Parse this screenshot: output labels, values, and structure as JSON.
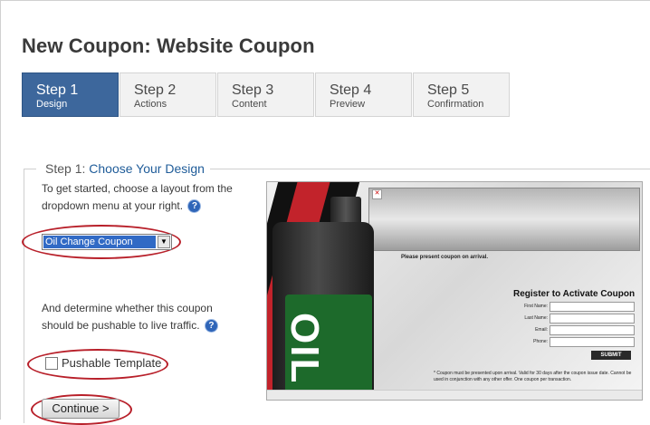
{
  "page": {
    "title": "New Coupon: Website Coupon"
  },
  "steps": [
    {
      "num": "Step 1",
      "label": "Design"
    },
    {
      "num": "Step 2",
      "label": "Actions"
    },
    {
      "num": "Step 3",
      "label": "Content"
    },
    {
      "num": "Step 4",
      "label": "Preview"
    },
    {
      "num": "Step 5",
      "label": "Confirmation"
    }
  ],
  "section": {
    "step_label": "Step 1:",
    "title": "Choose Your Design",
    "intro_line1": "To get started, choose a layout from the",
    "intro_line2": "dropdown menu at your right.",
    "layout_select": {
      "value": "Oil Change Coupon"
    },
    "pushable_line1": "And determine whether this coupon",
    "pushable_line2": "should be pushable to live traffic.",
    "pushable_checkbox_label": "Pushable Template",
    "pushable_checked": false,
    "continue_label": "Continue >"
  },
  "preview": {
    "present_text": "Please present coupon on arrival.",
    "bottle_text": "OIL",
    "register_title": "Register to Activate Coupon",
    "fields": [
      "First Name:",
      "Last Name:",
      "Email:",
      "Phone:"
    ],
    "submit_label": "SUBMIT",
    "fine_print": "* Coupon must be presented upon arrival. Valid for 30 days after the coupon issue date. Cannot be used in conjunction with any other offer. One coupon per transaction."
  },
  "colors": {
    "active_step": "#3d679c",
    "highlight": "#b8202a",
    "link_blue": "#1f5c99"
  },
  "icons": [
    "help-icon",
    "dropdown-arrow-icon",
    "broken-image-icon"
  ]
}
